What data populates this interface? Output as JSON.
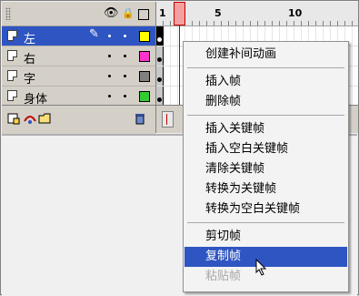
{
  "ruler": {
    "numbers": [
      "1",
      "5",
      "10"
    ]
  },
  "header_icons": {
    "eye": "eye-icon",
    "lock": "lock-icon",
    "outline": "outline-icon"
  },
  "layers": [
    {
      "name": "左",
      "color": "#ffff00",
      "selected": true
    },
    {
      "name": "右",
      "color": "#ff33cc",
      "selected": false
    },
    {
      "name": "字",
      "color": "#808080",
      "selected": false
    },
    {
      "name": "身体",
      "color": "#33cc33",
      "selected": false
    }
  ],
  "footer_icons": [
    "add-layer-icon",
    "add-motion-guide-icon",
    "add-folder-icon",
    "trash-icon"
  ],
  "context_menu": {
    "items": [
      {
        "label": "创建补间动画",
        "group": 0
      },
      {
        "label": "插入帧",
        "group": 1
      },
      {
        "label": "删除帧",
        "group": 1
      },
      {
        "label": "插入关键帧",
        "group": 2
      },
      {
        "label": "插入空白关键帧",
        "group": 2
      },
      {
        "label": "清除关键帧",
        "group": 2
      },
      {
        "label": "转换为关键帧",
        "group": 2
      },
      {
        "label": "转换为空白关键帧",
        "group": 2
      },
      {
        "label": "剪切帧",
        "group": 3
      },
      {
        "label": "复制帧",
        "group": 3,
        "highlighted": true
      },
      {
        "label": "粘贴帧",
        "group": 3,
        "disabled": true
      }
    ]
  },
  "colors": {
    "selection": "#2e55c2",
    "playhead": "#f5a0a0",
    "panel": "#d4d0c8"
  }
}
